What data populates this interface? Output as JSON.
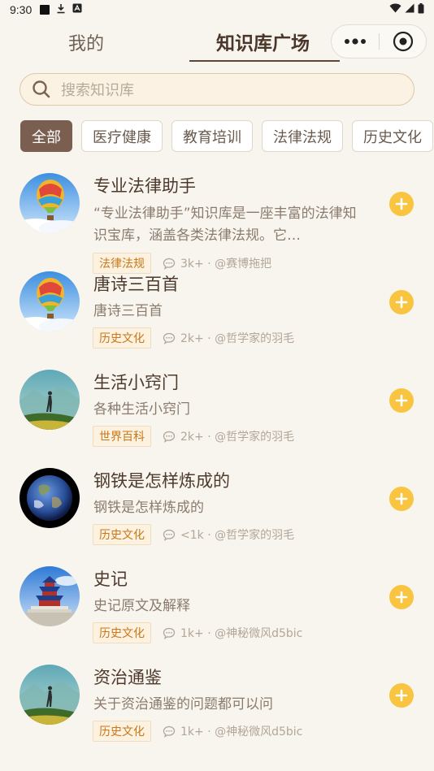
{
  "status_bar": {
    "time": "9:30"
  },
  "header": {
    "tabs": [
      {
        "label": "我的"
      },
      {
        "label": "知识库广场"
      }
    ]
  },
  "search": {
    "placeholder": "搜索知识库"
  },
  "categories": [
    "全部",
    "医疗健康",
    "教育培训",
    "法律法规",
    "历史文化"
  ],
  "items": [
    {
      "title": "专业法律助手",
      "description": "“专业法律助手”知识库是一座丰富的法律知识宝库，涵盖各类法律法规。它…",
      "tag": "法律法规",
      "stats": "3k+ · @赛博拖把",
      "avatar": "hot-air-balloon"
    },
    {
      "title": "唐诗三百首",
      "description": "唐诗三百首",
      "tag": "历史文化",
      "stats": "2k+ · @哲学家的羽毛",
      "avatar": "hot-air-balloon"
    },
    {
      "title": "生活小窍门",
      "description": "各种生活小窍门",
      "tag": "世界百科",
      "stats": "2k+ · @哲学家的羽毛",
      "avatar": "hiker-landscape"
    },
    {
      "title": "钢铁是怎样炼成的",
      "description": "钢铁是怎样炼成的",
      "tag": "历史文化",
      "stats": "<1k · @哲学家的羽毛",
      "avatar": "earth"
    },
    {
      "title": "史记",
      "description": "史记原文及解释",
      "tag": "历史文化",
      "stats": "1k+ · @神秘微风d5bic",
      "avatar": "temple-of-heaven"
    },
    {
      "title": "资治通鉴",
      "description": "关于资治通鉴的问题都可以问",
      "tag": "历史文化",
      "stats": "1k+ · @神秘微风d5bic",
      "avatar": "hiker-landscape"
    }
  ],
  "colors": {
    "background": "#f8f5ee",
    "active_chip": "#7a5e50",
    "tag_text": "#c8781a",
    "add_button": "#f9c440"
  }
}
